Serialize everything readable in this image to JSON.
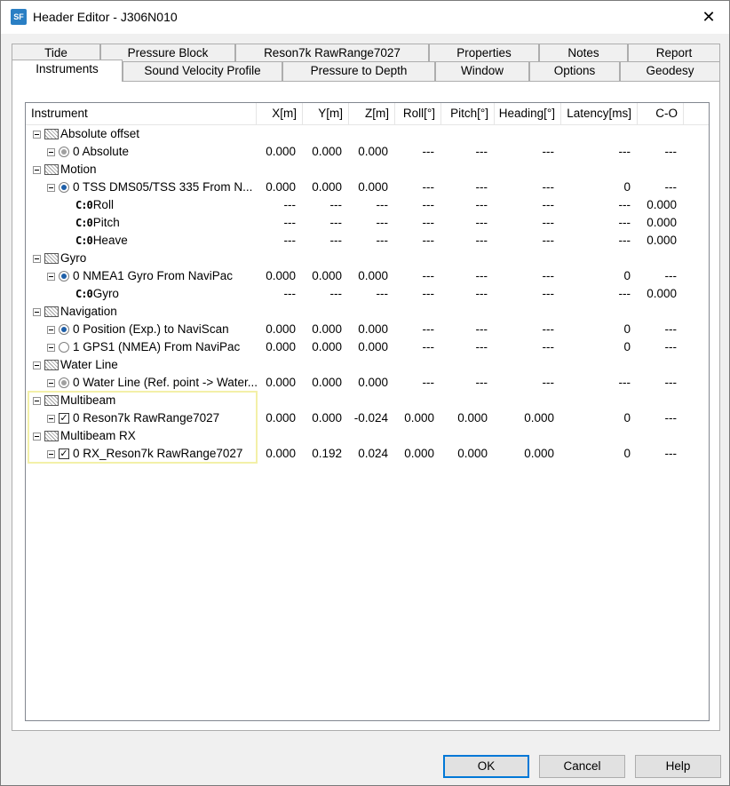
{
  "window": {
    "title": "Header Editor - J306N010",
    "app_icon": "SF",
    "close_glyph": "✕"
  },
  "tabs_back": [
    "Tide",
    "Pressure Block",
    "Reson7k RawRange7027",
    "Properties",
    "Notes",
    "Report"
  ],
  "tabs_front": [
    "Instruments",
    "Sound Velocity Profile",
    "Pressure to Depth",
    "Window",
    "Options",
    "Geodesy"
  ],
  "active_tab": "Instruments",
  "table": {
    "columns": [
      "Instrument",
      "X[m]",
      "Y[m]",
      "Z[m]",
      "Roll[°]",
      "Pitch[°]",
      "Heading[°]",
      "Latency[ms]",
      "C-O"
    ],
    "rows": [
      {
        "kind": "group",
        "label": "Absolute offset"
      },
      {
        "kind": "item",
        "marker": "radio-gray",
        "label": "0 Absolute",
        "values": [
          "0.000",
          "0.000",
          "0.000",
          "---",
          "---",
          "---",
          "---",
          "---"
        ]
      },
      {
        "kind": "group",
        "label": "Motion"
      },
      {
        "kind": "item",
        "marker": "radio-on",
        "label": "0 TSS DMS05/TSS 335 From N...",
        "values": [
          "0.000",
          "0.000",
          "0.000",
          "---",
          "---",
          "---",
          "0",
          "---"
        ]
      },
      {
        "kind": "sub",
        "icon": "C:0",
        "label": "Roll",
        "values": [
          "---",
          "---",
          "---",
          "---",
          "---",
          "---",
          "---",
          "0.000"
        ]
      },
      {
        "kind": "sub",
        "icon": "C:0",
        "label": "Pitch",
        "values": [
          "---",
          "---",
          "---",
          "---",
          "---",
          "---",
          "---",
          "0.000"
        ]
      },
      {
        "kind": "sub",
        "icon": "C:0",
        "label": "Heave",
        "values": [
          "---",
          "---",
          "---",
          "---",
          "---",
          "---",
          "---",
          "0.000"
        ]
      },
      {
        "kind": "group",
        "label": "Gyro"
      },
      {
        "kind": "item",
        "marker": "radio-on",
        "label": "0 NMEA1 Gyro From NaviPac",
        "values": [
          "0.000",
          "0.000",
          "0.000",
          "---",
          "---",
          "---",
          "0",
          "---"
        ]
      },
      {
        "kind": "sub",
        "icon": "C:0",
        "label": "Gyro",
        "values": [
          "---",
          "---",
          "---",
          "---",
          "---",
          "---",
          "---",
          "0.000"
        ]
      },
      {
        "kind": "group",
        "label": "Navigation"
      },
      {
        "kind": "item",
        "marker": "radio-on",
        "label": "0 Position (Exp.) to NaviScan",
        "values": [
          "0.000",
          "0.000",
          "0.000",
          "---",
          "---",
          "---",
          "0",
          "---"
        ]
      },
      {
        "kind": "item",
        "marker": "radio-off",
        "label": "1 GPS1 (NMEA) From NaviPac",
        "values": [
          "0.000",
          "0.000",
          "0.000",
          "---",
          "---",
          "---",
          "0",
          "---"
        ]
      },
      {
        "kind": "group",
        "label": "Water Line"
      },
      {
        "kind": "item",
        "marker": "radio-gray",
        "label": "0 Water Line (Ref. point -> Water...",
        "values": [
          "0.000",
          "0.000",
          "0.000",
          "---",
          "---",
          "---",
          "---",
          "---"
        ]
      },
      {
        "kind": "group",
        "label": "Multibeam"
      },
      {
        "kind": "item",
        "marker": "check",
        "label": "0 Reson7k RawRange7027",
        "values": [
          "0.000",
          "0.000",
          "-0.024",
          "0.000",
          "0.000",
          "0.000",
          "0",
          "---"
        ]
      },
      {
        "kind": "group",
        "label": "Multibeam RX"
      },
      {
        "kind": "item",
        "marker": "check",
        "label": "0 RX_Reson7k RawRange7027",
        "values": [
          "0.000",
          "0.192",
          "0.024",
          "0.000",
          "0.000",
          "0.000",
          "0",
          "---"
        ]
      }
    ]
  },
  "buttons": {
    "ok": "OK",
    "cancel": "Cancel",
    "help": "Help"
  },
  "check_glyph": "✓"
}
